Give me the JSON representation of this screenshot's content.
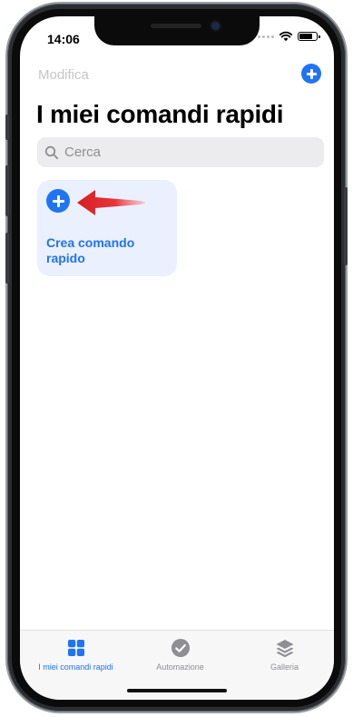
{
  "status_bar": {
    "time": "14:06",
    "battery_level": 0.85
  },
  "nav": {
    "edit_label": "Modifica",
    "add_icon": "plus-circle-icon"
  },
  "title": "I miei comandi rapidi",
  "search": {
    "placeholder": "Cerca",
    "value": ""
  },
  "create_card": {
    "label": "Crea comando rapido",
    "icon": "plus-circle-icon",
    "annotation_icon": "red-arrow-icon"
  },
  "tabbar": {
    "tabs": [
      {
        "label": "I miei comandi rapidi",
        "icon": "grid-icon",
        "active": true
      },
      {
        "label": "Automazione",
        "icon": "clock-check-icon",
        "active": false
      },
      {
        "label": "Galleria",
        "icon": "layers-icon",
        "active": false
      }
    ]
  },
  "colors": {
    "accent": "#1f74f2",
    "card_bg": "#eaf0fd",
    "inactive": "#8e8e93",
    "annotation": "#e0262b"
  }
}
